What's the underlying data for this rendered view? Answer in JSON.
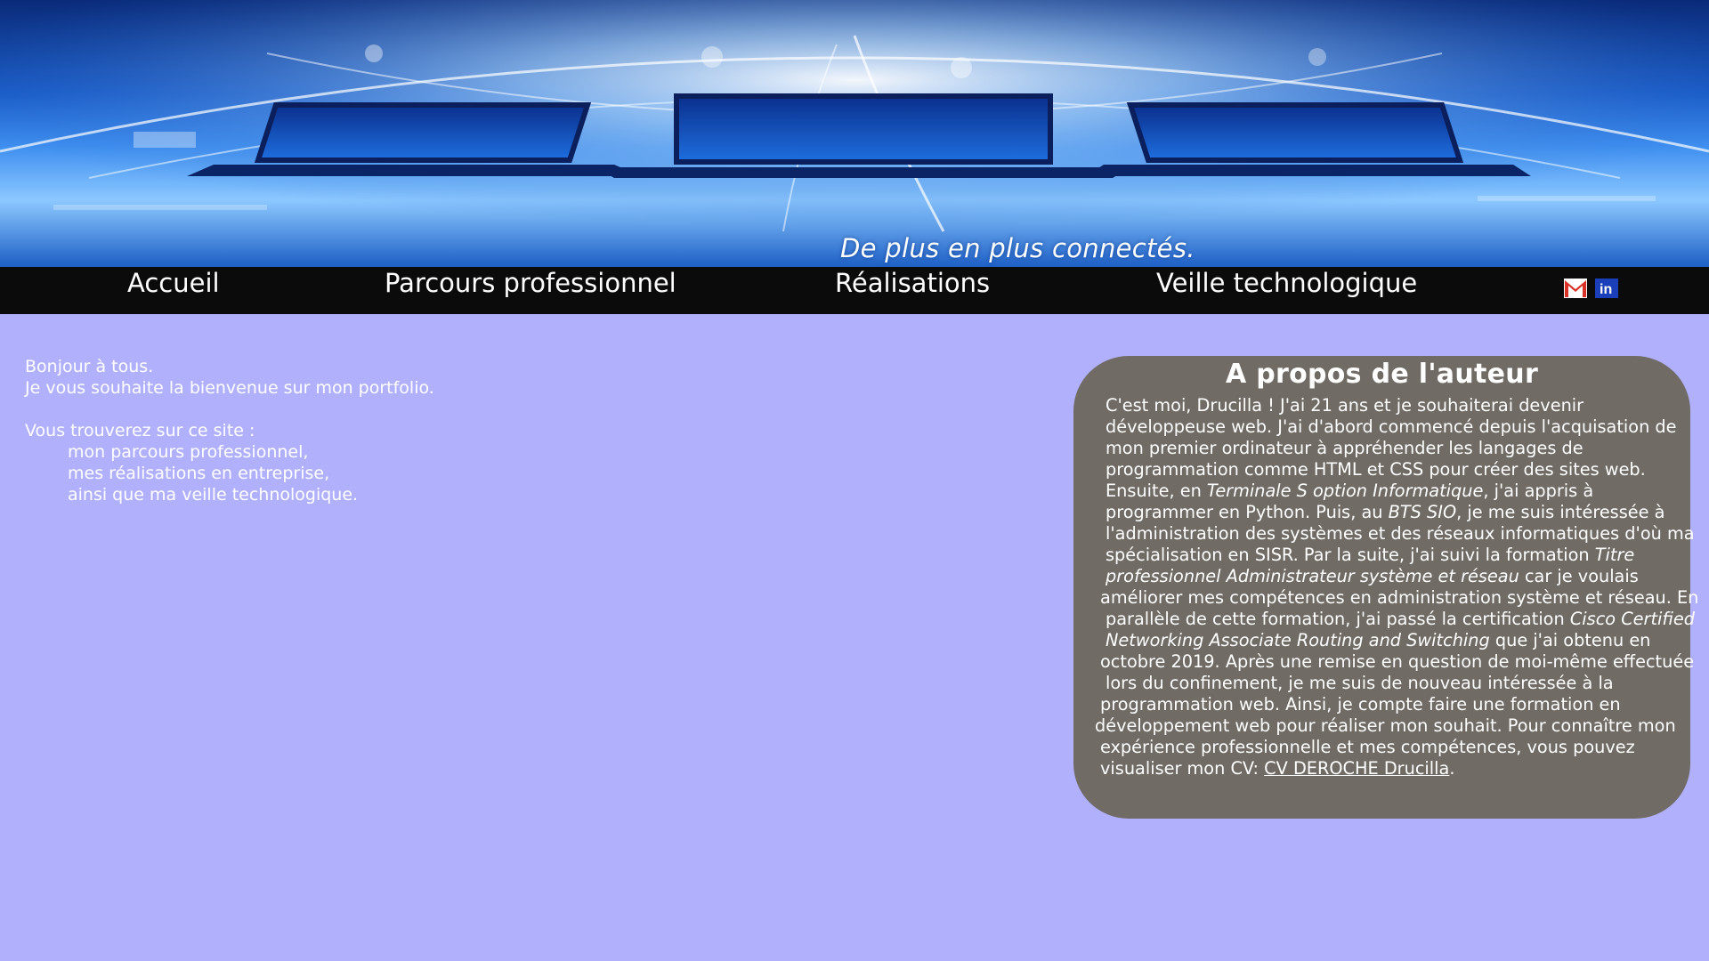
{
  "header": {
    "tagline": "De plus en plus connectés.",
    "banner_image": "network-laptops-banner"
  },
  "nav": {
    "items": [
      {
        "label": "Accueil"
      },
      {
        "label": "Parcours professionnel"
      },
      {
        "label": "Réalisations"
      },
      {
        "label": "Veille technologique"
      }
    ],
    "social": [
      {
        "icon": "gmail-icon"
      },
      {
        "icon": "linkedin-icon",
        "text": "in"
      }
    ]
  },
  "intro": {
    "line1": "Bonjour à tous.",
    "line2": "Je vous souhaite la bienvenue sur mon portfolio.",
    "line3": "Vous trouverez sur ce site :",
    "items": [
      "mon parcours professionnel,",
      "mes réalisations en entreprise,",
      "ainsi que ma veille technologique."
    ]
  },
  "about": {
    "title": "A propos de l'auteur",
    "l1": "C'est moi, Drucilla ! J'ai 21 ans et je souhaiterai devenir",
    "l2": "développeuse web. J'ai d'abord commencé depuis l'acquisation de",
    "l3": "mon premier ordinateur à appréhender  les langages de",
    "l4": "programmation comme HTML et CSS pour créer des sites web.",
    "l5a": "Ensuite, en ",
    "l5b": "Terminale S option Informatique",
    "l5c": ", j'ai appris à",
    "l6a": "programmer en Python.  Puis, au ",
    "l6b": "BTS SIO",
    "l6c": ", je me suis intéressée à",
    "l7": "l'administration des systèmes et des réseaux informatiques d'où ma",
    "l8a": "spécialisation en SISR. Par la suite, j'ai suivi la formation ",
    "l8b": "Titre",
    "l9a": "professionnel Administrateur système et réseau",
    "l9b": " car je voulais",
    "l10": "améliorer mes compétences en administration système et réseau. En",
    "l11a": "parallèle de cette formation, j'ai passé la certification ",
    "l11b": "Cisco Certified",
    "l12a": "Networking Associate Routing and Switching",
    "l12b": " que j'ai obtenu en",
    "l13": "octobre 2019. Après une remise en question de moi-même effectuée",
    "l14": "lors du confinement, je me suis de nouveau intéressée à la",
    "l15": "programmation web. Ainsi, je compte faire une formation en",
    "l16": "développement web pour réaliser mon souhait. Pour connaître mon",
    "l17": "expérience professionnelle et mes compétences, vous pouvez",
    "l18a": "visualiser mon CV: ",
    "cv_link": "CV DEROCHE Drucilla",
    "l18b": "."
  },
  "colors": {
    "page_bg": "#b0b0fd",
    "navbar_bg": "#0b0b0b",
    "about_bg": "#706b64",
    "text": "#ffffff"
  }
}
